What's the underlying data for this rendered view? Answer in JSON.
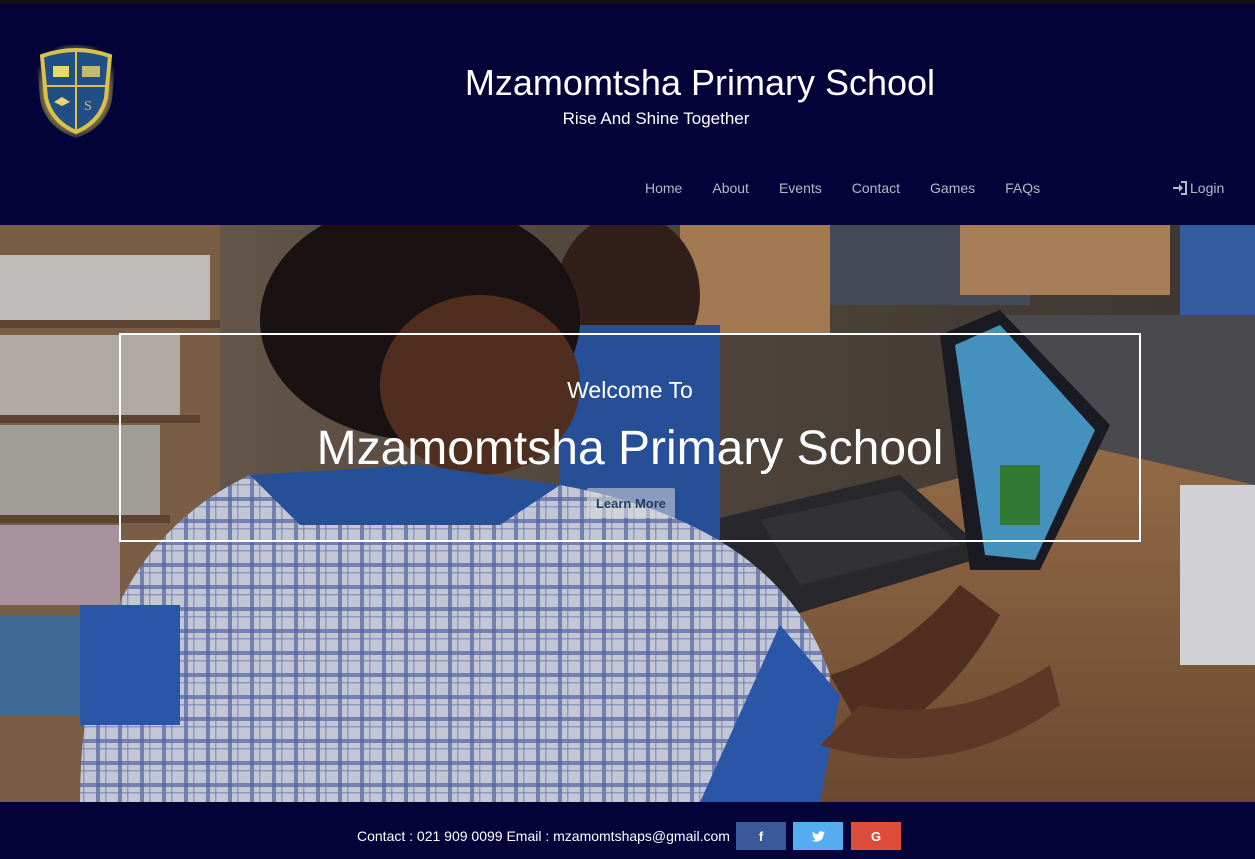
{
  "header": {
    "school_name": "Mzamomtsha Primary School",
    "tagline": "Rise And Shine Together",
    "logo_letter": "S"
  },
  "nav": {
    "items": [
      "Home",
      "About",
      "Events",
      "Contact",
      "Games",
      "FAQs"
    ],
    "login_label": "Login"
  },
  "hero": {
    "welcome": "Welcome To",
    "title": "Mzamomtsha Primary School",
    "button_label": "Learn More"
  },
  "footer": {
    "contact_text": "Contact : 021 909 0099 Email : mzamomtshaps@gmail.com",
    "social": [
      {
        "icon": "facebook-icon",
        "label": "f",
        "color": "#3b5998"
      },
      {
        "icon": "twitter-icon",
        "label": "t",
        "color": "#55acee"
      },
      {
        "icon": "google-icon",
        "label": "G",
        "color": "#dd4b39"
      }
    ]
  },
  "colors": {
    "header_bg": "#03033a",
    "text": "#ffffff",
    "nav_text": "#b9b9c6"
  }
}
